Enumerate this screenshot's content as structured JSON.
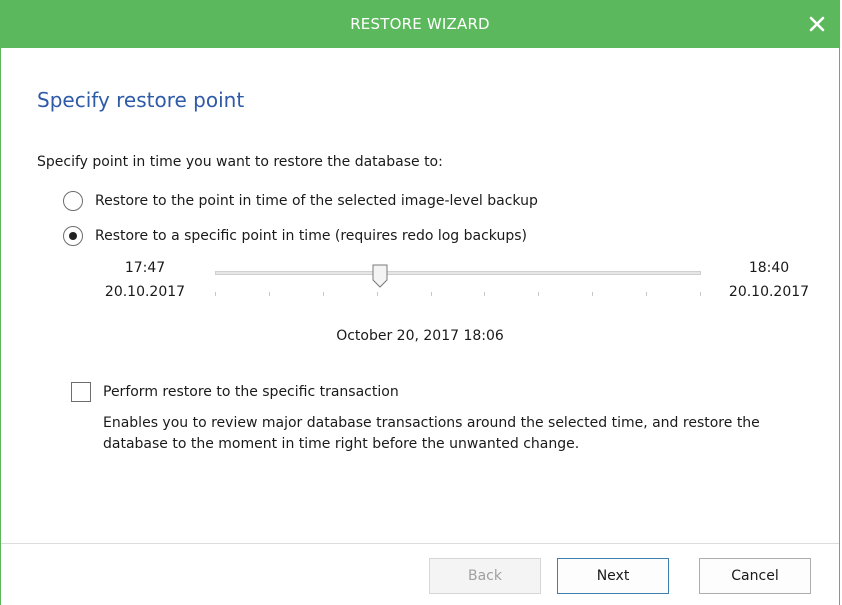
{
  "window": {
    "title": "RESTORE WIZARD",
    "accent_color": "#5cb85c",
    "close_icon": "close-icon"
  },
  "page": {
    "heading": "Specify restore point",
    "prompt": "Specify point in time you want to restore the database to:"
  },
  "options": [
    {
      "label": "Restore to the point in time of the selected image-level backup",
      "selected": false
    },
    {
      "label": "Restore to a specific point in time (requires redo log backups)",
      "selected": true
    }
  ],
  "timeline": {
    "start_time": "17:47",
    "start_date": "20.10.2017",
    "end_time": "18:40",
    "end_date": "20.10.2017",
    "position_fraction": 0.34,
    "selected_label": "October 20,  2017    18:06"
  },
  "transaction": {
    "label": "Perform restore to the specific transaction",
    "checked": false,
    "description": "Enables you to review major database transactions around the selected time, and restore the database to the moment in time right before the unwanted change."
  },
  "footer": {
    "back_label": "Back",
    "next_label": "Next",
    "cancel_label": "Cancel"
  }
}
